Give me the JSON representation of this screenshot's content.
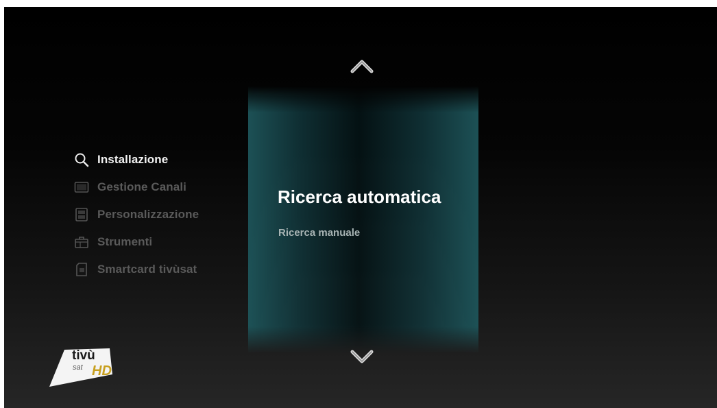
{
  "menu": {
    "items": [
      {
        "label": "Installazione",
        "icon": "search-icon",
        "active": true
      },
      {
        "label": "Gestione Canali",
        "icon": "tv-icon",
        "active": false
      },
      {
        "label": "Personalizzazione",
        "icon": "settings-panel-icon",
        "active": false
      },
      {
        "label": "Strumenti",
        "icon": "toolbox-icon",
        "active": false
      },
      {
        "label": "Smartcard tivùsat",
        "icon": "smartcard-icon",
        "active": false
      }
    ]
  },
  "options": {
    "selected": "Ricerca automatica",
    "next": "Ricerca manuale"
  },
  "navigation": {
    "up_icon": "chevron-up-icon",
    "down_icon": "chevron-down-icon"
  },
  "logo": {
    "main": "tivù",
    "sub": "sat",
    "hd": "HD"
  },
  "colors": {
    "panel_accent": "#1e555a",
    "active_text": "#f2f2f2",
    "inactive_text": "#5a5a5a",
    "hd_gold": "#c8a020"
  }
}
